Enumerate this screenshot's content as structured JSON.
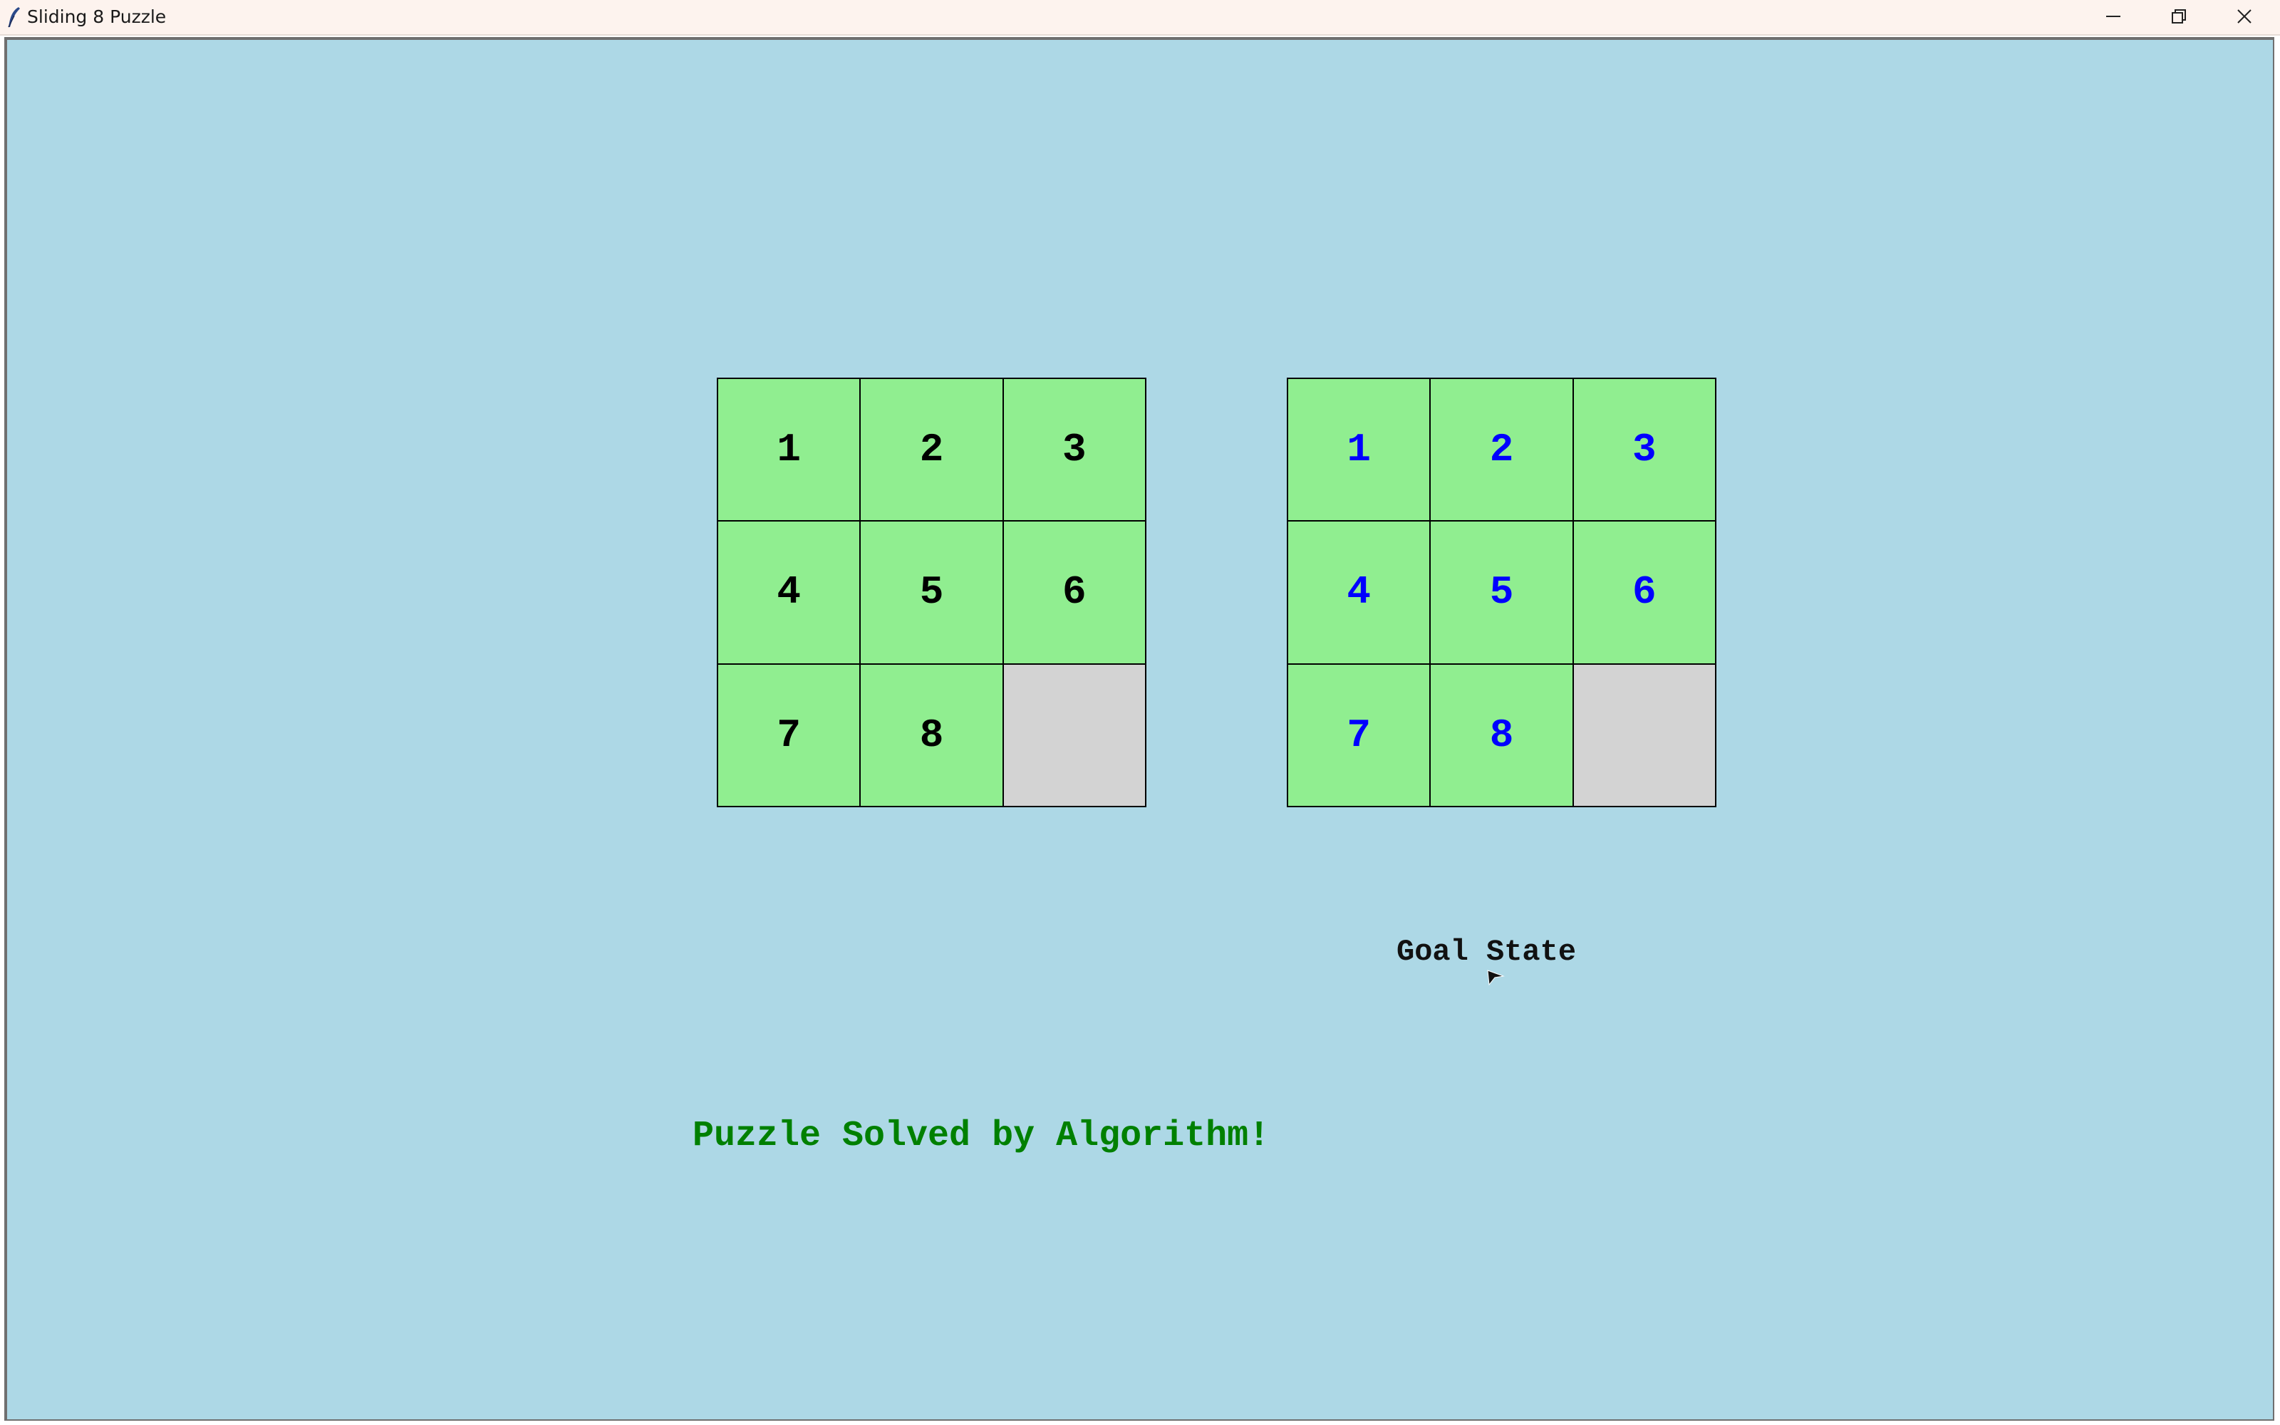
{
  "window": {
    "title": "Sliding 8 Puzzle",
    "icons": {
      "app": "feather-icon",
      "minimize": "minimize-icon",
      "maximize": "restore-icon",
      "close": "close-icon"
    }
  },
  "colors": {
    "background": "#add8e6",
    "tile": "#90ee90",
    "empty_tile": "#d3d3d3",
    "current_text": "#000000",
    "goal_text": "#0000ff",
    "status_text": "#008000"
  },
  "current_board": {
    "tiles": [
      "1",
      "2",
      "3",
      "4",
      "5",
      "6",
      "7",
      "8",
      ""
    ]
  },
  "goal_board": {
    "label": "Goal State",
    "tiles": [
      "1",
      "2",
      "3",
      "4",
      "5",
      "6",
      "7",
      "8",
      ""
    ]
  },
  "status": {
    "message": "Puzzle Solved by Algorithm!"
  }
}
